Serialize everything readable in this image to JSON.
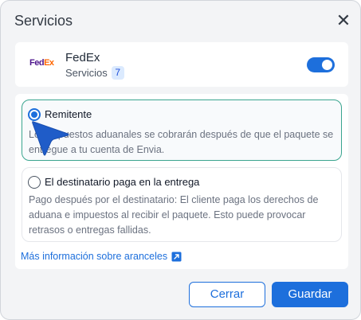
{
  "modal": {
    "title": "Servicios",
    "close_label": "✕"
  },
  "carrier": {
    "logo_part1": "Fed",
    "logo_part2": "Ex",
    "name": "FedEx",
    "subtitle": "Servicios",
    "count": "7",
    "enabled": true
  },
  "options": [
    {
      "title": "Remitente",
      "description": "Los impuestos aduanales se cobrarán después de que el paquete se entregue a tu cuenta de Envia.",
      "selected": true
    },
    {
      "title": "El destinatario paga en la entrega",
      "description": "Pago después por el destinatario: El cliente paga los derechos de aduana e impuestos al recibir el paquete. Esto puede provocar retrasos o entregas fallidas.",
      "selected": false
    }
  ],
  "info_link": "Más información sobre aranceles",
  "buttons": {
    "cancel": "Cerrar",
    "save": "Guardar"
  },
  "colors": {
    "primary": "#1d6fdc",
    "selected_border": "#3aa58f"
  }
}
